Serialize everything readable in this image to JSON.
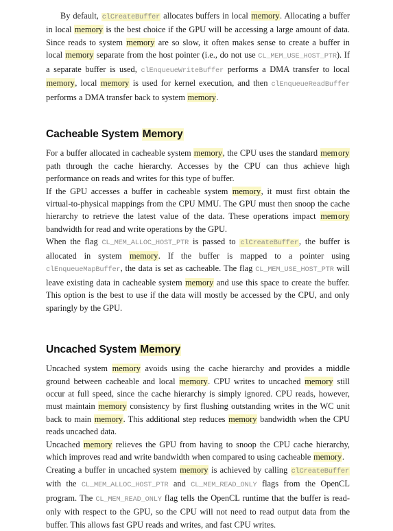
{
  "document": {
    "page_background": "#ffffff",
    "text_color": "#1b1b1b",
    "highlight_color": "#faf7c5",
    "code_color": "#8d8d8d",
    "blocks": [
      {
        "type": "paragraph",
        "id": "p1",
        "indent": true,
        "text": "By default, clCreateBuffer allocates buffers in local memory. Allocating a buffer in local memory is the best choice if the GPU will be accessing a large amount of data. Since reads to system memory are so slow, it often makes sense to create a buffer in local memory separate from the host pointer (i.e., do not use CL_MEM_USE_HOST_PTR). If a separate buffer is used, clEnqueueWriteBuffer performs a DMA transfer to local memory, local memory is used for kernel execution, and then clEnqueueReadBuffer performs a DMA transfer back to system memory."
      },
      {
        "type": "heading",
        "id": "h1",
        "text": "Cacheable System Memory",
        "plain": "Cacheable System ",
        "highlighted": "Memory"
      },
      {
        "type": "paragraph",
        "id": "p2",
        "indent": false,
        "text": "For a buffer allocated in cacheable system memory, the CPU uses the standard memory path through the cache hierarchy. Accesses by the CPU can thus achieve high performance on reads and writes for this type of buffer."
      },
      {
        "type": "paragraph",
        "id": "p3",
        "indent": true,
        "text": "If the GPU accesses a buffer in cacheable system memory, it must first obtain the virtual-to-physical mappings from the CPU MMU. The GPU must then snoop the cache hierarchy to retrieve the latest value of the data. These operations impact memory bandwidth for read and write operations by the GPU."
      },
      {
        "type": "paragraph",
        "id": "p4",
        "indent": true,
        "text": "When the flag CL_MEM_ALLOC_HOST_PTR is passed to clCreateBuffer, the buffer is allocated in system memory. If the buffer is mapped to a pointer using clEnqueueMapBuffer, the data is set as cacheable. The flag CL_MEM_USE_HOST_PTR will leave existing data in cacheable system memory and use this space to create the buffer. This option is the best to use if the data will mostly be accessed by the CPU, and only sparingly by the GPU."
      },
      {
        "type": "heading",
        "id": "h2",
        "text": "Uncached System Memory",
        "plain": "Uncached System ",
        "highlighted": "Memory"
      },
      {
        "type": "paragraph",
        "id": "p5",
        "indent": false,
        "text": "Uncached system memory avoids using the cache hierarchy and provides a middle ground between cacheable and local memory. CPU writes to uncached memory still occur at full speed, since the cache hierarchy is simply ignored. CPU reads, however, must maintain memory consistency by first flushing outstanding writes in the WC unit back to main memory. This additional step reduces memory bandwidth when the CPU reads uncached data."
      },
      {
        "type": "paragraph",
        "id": "p6",
        "indent": true,
        "text": "Uncached memory relieves the GPU from having to snoop the CPU cache hierarchy, which improves read and write bandwidth when compared to using cacheable memory."
      },
      {
        "type": "paragraph",
        "id": "p7",
        "indent": true,
        "text": "Creating a buffer in uncached system memory is achieved by calling clCreateBuffer with the CL_MEM_ALLOC_HOST_PTR and CL_MEM_READ_ONLY flags from the OpenCL program. The CL_MEM_READ_ONLY flag tells the OpenCL runtime that the buffer is read-only with respect to the GPU, so the CPU will not need to read output data from the buffer. This allows fast GPU reads and writes, and fast CPU writes."
      }
    ],
    "code_tokens": [
      "clCreateBuffer",
      "CL_MEM_USE_HOST_PTR",
      "clEnqueueWriteBuffer",
      "clEnqueueReadBuffer",
      "CL_MEM_ALLOC_HOST_PTR",
      "clEnqueueMapBuffer",
      "CL_MEM_READ_ONLY"
    ],
    "highlight_term": "memory"
  }
}
